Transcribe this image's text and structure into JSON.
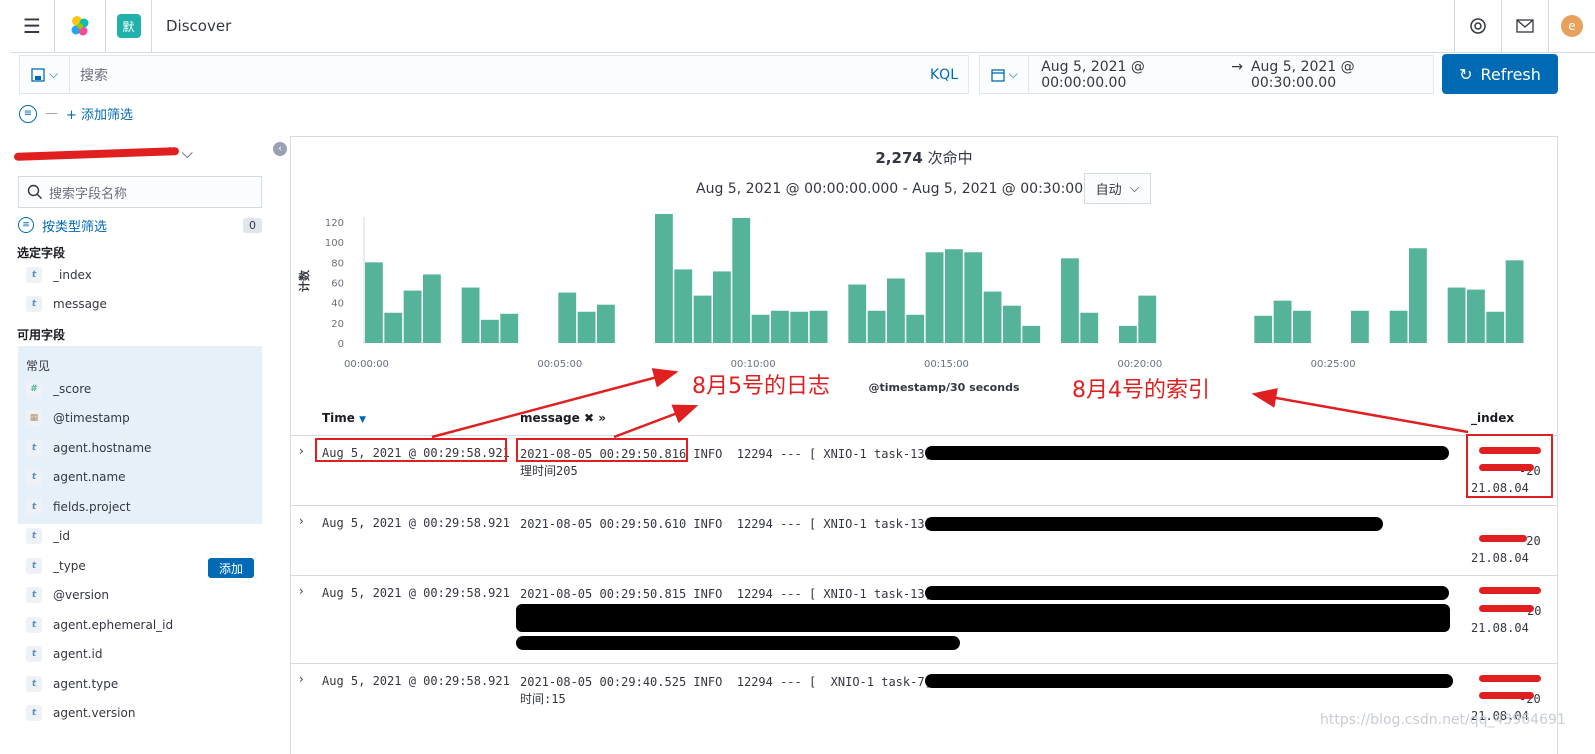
{
  "header": {
    "title": "Discover",
    "space_initial": "默",
    "user_initial": "e"
  },
  "query": {
    "placeholder": "搜索",
    "language": "KQL"
  },
  "date": {
    "start": "Aug 5, 2021 @ 00:00:00.00",
    "end": "Aug 5, 2021 @ 00:30:00.00",
    "refresh_label": "Refresh"
  },
  "filters": {
    "add_label": "+ 添加筛选"
  },
  "sidebar": {
    "index_pattern_suffix": "*",
    "field_search_placeholder": "搜索字段名称",
    "type_filter_label": "按类型筛选",
    "type_filter_count": "0",
    "selected_title": "选定字段",
    "selected_fields": [
      "_index",
      "message"
    ],
    "available_title": "可用字段",
    "common_title": "常见",
    "common_fields": [
      "_score",
      "@timestamp",
      "agent.hostname",
      "agent.name",
      "fields.project"
    ],
    "other_fields": [
      "_id",
      "_type",
      "@version",
      "agent.ephemeral_id",
      "agent.id",
      "agent.type",
      "agent.version"
    ],
    "add_button": "添加"
  },
  "histogram": {
    "hits_count": "2,274",
    "hits_label": "次命中",
    "time_range": "Aug 5, 2021 @ 00:00:00.000 - Aug 5, 2021 @ 00:30:00.000",
    "interval": "自动",
    "ylabel": "计数",
    "xlabel": "@timestamp/30 seconds"
  },
  "chart_data": {
    "type": "bar",
    "title": "",
    "xlabel": "@timestamp/30 seconds",
    "ylabel": "计数",
    "ylim": [
      0,
      125
    ],
    "y_ticks": [
      0,
      20,
      40,
      60,
      80,
      100,
      120
    ],
    "x_ticks": [
      "00:00:00",
      "00:05:00",
      "00:10:00",
      "00:15:00",
      "00:20:00",
      "00:25:00"
    ],
    "bar_color": "#54b399",
    "values": [
      80,
      30,
      52,
      68,
      0,
      0,
      55,
      23,
      29,
      0,
      0,
      0,
      50,
      31,
      38,
      0,
      0,
      0,
      0,
      0,
      0,
      0,
      0,
      0,
      0,
      0,
      0,
      0,
      0,
      0,
      58,
      32,
      64,
      28,
      90,
      93,
      90,
      51,
      37,
      17,
      0,
      84,
      30,
      0,
      17,
      47,
      0,
      0,
      0,
      0,
      0,
      0,
      27,
      42,
      32,
      0,
      0,
      32,
      0,
      32,
      94,
      0,
      55,
      53,
      31,
      82
    ],
    "values_min1": [
      128,
      73,
      47,
      71,
      124,
      28,
      32,
      31,
      32
    ]
  },
  "table": {
    "col_time": "Time",
    "col_message": "message",
    "col_index": "_index",
    "rows": [
      {
        "time": "Aug 5, 2021 @ 00:29:58.921",
        "message": "2021-08-05 00:29:50.816 INFO  12294 --- [ XNIO-1 task-13] ",
        "message2": "理时间205",
        "index_tail": "-20",
        "index_date": "21.08.04"
      },
      {
        "time": "Aug 5, 2021 @ 00:29:58.921",
        "message": "2021-08-05 00:29:50.610 INFO  12294 --- [ XNIO-1 task-13] ",
        "message2": "",
        "index_tail": "-20",
        "index_date": "21.08.04"
      },
      {
        "time": "Aug 5, 2021 @ 00:29:58.921",
        "message": "2021-08-05 00:29:50.815 INFO  12294 --- [ XNIO-1 task-13] ",
        "message2": "",
        "index_tail": "20",
        "index_date": "21.08.04"
      },
      {
        "time": "Aug 5, 2021 @ 00:29:58.921",
        "message": "2021-08-05 00:29:40.525 INFO  12294 --- [  XNIO-1 task-7] ",
        "message2": "时间:15",
        "index_tail": "-20",
        "index_date": "21.08.04"
      }
    ]
  },
  "annotations": {
    "log_label": "8月5号的日志",
    "index_label": "8月4号的索引"
  },
  "watermark": "https://blog.csdn.net/qq_43964691"
}
